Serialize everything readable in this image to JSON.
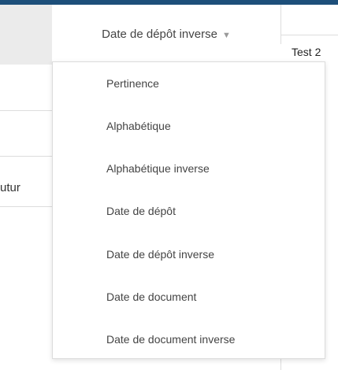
{
  "sort": {
    "current_label": "Date de dépôt inverse",
    "caret_icon": "chevron-down-icon",
    "options": [
      "Pertinence",
      "Alphabétique",
      "Alphabétique inverse",
      "Date de dépôt",
      "Date de dépôt inverse",
      "Date de document",
      "Date de document inverse"
    ]
  },
  "results": {
    "first_title_partial": "Test 2",
    "left_partial_text": "utur"
  },
  "colors": {
    "topbar": "#1d4f7a",
    "panel_grey": "#ebebeb"
  }
}
